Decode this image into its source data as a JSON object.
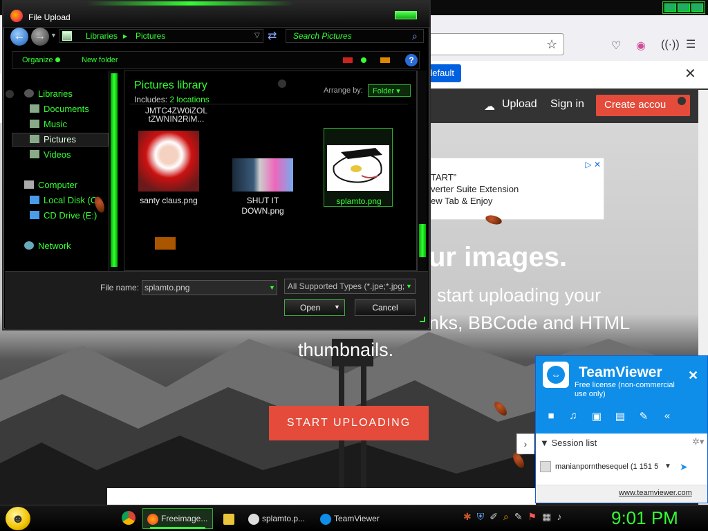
{
  "browser": {
    "set_default": "default",
    "nav_upload": "Upload",
    "nav_signin": "Sign in",
    "nav_create": "Create accou",
    "ad_lines": [
      "TART”",
      "verter Suite Extension",
      "ew Tab & Enjoy"
    ],
    "hero_title": "ur images.",
    "hero_sub1": "start uploading your",
    "hero_sub2": "nks, BBCode and HTML",
    "hero_sub3": "thumbnails.",
    "start_uploading": "START UPLOADING"
  },
  "dialog": {
    "title": "File Upload",
    "breadcrumbs": [
      "Libraries",
      "Pictures"
    ],
    "breadcrumb_sep": "▸",
    "search_placeholder": "Search Pictures",
    "organize": "Organize",
    "new_folder": "New folder",
    "help": "?",
    "nav_items": [
      {
        "label": "Libraries"
      },
      {
        "label": "Documents"
      },
      {
        "label": "Music"
      },
      {
        "label": "Pictures"
      },
      {
        "label": "Videos"
      },
      {
        "label": "Computer"
      },
      {
        "label": "Local Disk (C"
      },
      {
        "label": "CD Drive (E:)"
      },
      {
        "label": "Network"
      }
    ],
    "library_title": "Pictures library",
    "includes_label": "Includes:",
    "includes_locations": "2 locations",
    "arrange_label": "Arrange by:",
    "arrange_value": "Folder",
    "partial_name_top": "JMTC4ZW0iZOL",
    "partial_name_bottom": "tZWNIN2RiM...",
    "files": [
      {
        "name": "santy claus.png"
      },
      {
        "name": "SHUT IT DOWN.png"
      },
      {
        "name": "splamto.png"
      }
    ],
    "filename_label": "File name:",
    "filename_value": "splamto.png",
    "filetype_value": "All Supported Types (*.jpe;*.jpg;",
    "open": "Open",
    "cancel": "Cancel"
  },
  "teamviewer": {
    "title": "TeamViewer",
    "license": "Free license (non-commercial use only)",
    "session_label": "Session list",
    "session_name": "manianpornthesequel (1 151 5",
    "link": "www.teamviewer.com"
  },
  "taskbar": {
    "freeimage": "Freeimage...",
    "splamto": "splamto.p...",
    "teamviewer": "TeamViewer",
    "clock": "9:01 PM"
  },
  "colors": {
    "accent_green": "#33ff33",
    "brand_red": "#e44b3a",
    "teamviewer_blue": "#0e8ee9"
  }
}
